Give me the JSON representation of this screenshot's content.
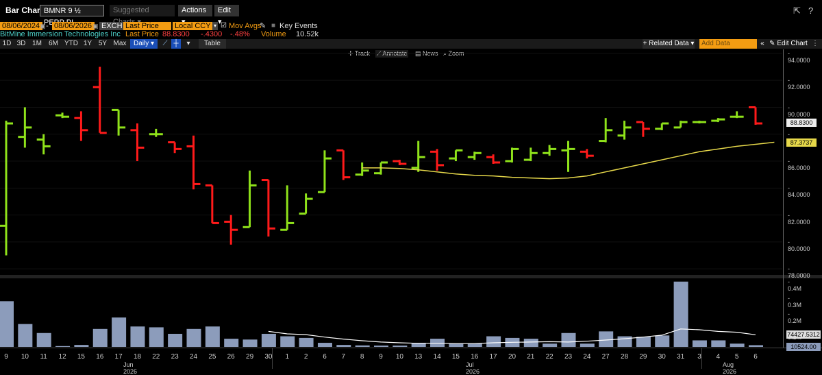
{
  "header": {
    "title": "Bar Chart",
    "ticker": "BMNR 9 ½ PERP PI",
    "suggested": "Suggested Charts",
    "actions": "Actions",
    "edit": "Edit"
  },
  "controls": {
    "start_date": "08/06/2024",
    "end_date": "08/06/2026",
    "exch": "EXCH",
    "price_field": "Last Price",
    "currency": "Local CCY",
    "mov_avgs": "Mov Avgs",
    "key_events": "Key Events"
  },
  "security": {
    "name": "BitMine Immersion Technologies Inc",
    "last_price_label": "Last Price",
    "last_price": "88.8300",
    "change": "-.4300",
    "change_pct": "-.48%",
    "volume_label": "Volume",
    "volume": "10.52k"
  },
  "toolbar": {
    "timeframes": [
      "1D",
      "3D",
      "1M",
      "6M",
      "YTD",
      "1Y",
      "5Y",
      "Max"
    ],
    "period": "Daily",
    "table": "Table",
    "related_data": "Related Data",
    "add_data_placeholder": "Add Data",
    "edit_chart": "Edit Chart",
    "track": "Track",
    "annotate": "Annotate",
    "news": "News",
    "zoom": "Zoom"
  },
  "colors": {
    "up": "#8fe21a",
    "down": "#ff1a1a",
    "ma": "#e6d84a",
    "volume": "#8c9cbb",
    "accent": "#f39c12"
  },
  "chart_data": {
    "type": "ohlc_bar",
    "ylim": [
      77.5,
      94.3
    ],
    "y_ticks": [
      "94.0000",
      "92.0000",
      "90.0000",
      "88.0000",
      "86.0000",
      "84.0000",
      "82.0000",
      "80.0000",
      "78.0000"
    ],
    "x_labels": [
      "9",
      "10",
      "11",
      "12",
      "15",
      "16",
      "17",
      "18",
      "22",
      "23",
      "24",
      "25",
      "26",
      "29",
      "30",
      "1",
      "2",
      "6",
      "7",
      "8",
      "9",
      "10",
      "13",
      "14",
      "15",
      "16",
      "17",
      "20",
      "21",
      "22",
      "23",
      "24",
      "27",
      "28",
      "29",
      "30",
      "31",
      "3",
      "4",
      "5",
      "6"
    ],
    "month_labels": [
      "Jun 2026",
      "Jul 2026",
      "Aug 2026"
    ],
    "bars": [
      {
        "o": 81.2,
        "h": 89.0,
        "l": 79.0,
        "c": 88.8,
        "up": true
      },
      {
        "o": 87.8,
        "h": 90.0,
        "l": 87.0,
        "c": 88.5,
        "up": true
      },
      {
        "o": 87.6,
        "h": 88.0,
        "l": 86.5,
        "c": 87.1,
        "up": true
      },
      {
        "o": 89.4,
        "h": 89.6,
        "l": 89.2,
        "c": 89.3,
        "up": true
      },
      {
        "o": 89.2,
        "h": 89.7,
        "l": 87.5,
        "c": 88.3,
        "up": false
      },
      {
        "o": 91.5,
        "h": 93.0,
        "l": 88.1,
        "c": 88.1,
        "up": false
      },
      {
        "o": 89.8,
        "h": 89.8,
        "l": 87.9,
        "c": 88.5,
        "up": true
      },
      {
        "o": 88.3,
        "h": 88.8,
        "l": 86.0,
        "c": 87.0,
        "up": false
      },
      {
        "o": 88.0,
        "h": 88.4,
        "l": 87.8,
        "c": 88.0,
        "up": true
      },
      {
        "o": 87.4,
        "h": 87.4,
        "l": 86.6,
        "c": 86.9,
        "up": false
      },
      {
        "o": 87.1,
        "h": 87.9,
        "l": 83.9,
        "c": 84.3,
        "up": false
      },
      {
        "o": 84.2,
        "h": 84.2,
        "l": 81.4,
        "c": 81.4,
        "up": false
      },
      {
        "o": 81.5,
        "h": 82.0,
        "l": 79.8,
        "c": 80.9,
        "up": false
      },
      {
        "o": 81.1,
        "h": 85.3,
        "l": 81.1,
        "c": 84.2,
        "up": true
      },
      {
        "o": 84.6,
        "h": 84.6,
        "l": 80.4,
        "c": 81.0,
        "up": false
      },
      {
        "o": 80.9,
        "h": 84.2,
        "l": 80.9,
        "c": 81.4,
        "up": true
      },
      {
        "o": 82.1,
        "h": 83.6,
        "l": 82.1,
        "c": 83.2,
        "up": true
      },
      {
        "o": 83.7,
        "h": 86.8,
        "l": 83.7,
        "c": 86.2,
        "up": true
      },
      {
        "o": 86.8,
        "h": 86.8,
        "l": 84.6,
        "c": 84.8,
        "up": false
      },
      {
        "o": 85.0,
        "h": 85.9,
        "l": 84.9,
        "c": 85.3,
        "up": true
      },
      {
        "o": 85.1,
        "h": 85.9,
        "l": 85.0,
        "c": 85.9,
        "up": true
      },
      {
        "o": 86.0,
        "h": 86.1,
        "l": 85.7,
        "c": 85.8,
        "up": false
      },
      {
        "o": 85.5,
        "h": 87.5,
        "l": 85.2,
        "c": 86.3,
        "up": true
      },
      {
        "o": 86.7,
        "h": 86.9,
        "l": 85.3,
        "c": 85.7,
        "up": false
      },
      {
        "o": 86.2,
        "h": 86.8,
        "l": 86.0,
        "c": 86.8,
        "up": true
      },
      {
        "o": 86.3,
        "h": 86.7,
        "l": 86.1,
        "c": 86.6,
        "up": true
      },
      {
        "o": 86.3,
        "h": 86.5,
        "l": 85.8,
        "c": 85.9,
        "up": false
      },
      {
        "o": 86.0,
        "h": 87.0,
        "l": 85.9,
        "c": 86.9,
        "up": true
      },
      {
        "o": 86.1,
        "h": 87.0,
        "l": 86.0,
        "c": 86.6,
        "up": true
      },
      {
        "o": 86.6,
        "h": 87.2,
        "l": 86.4,
        "c": 86.9,
        "up": true
      },
      {
        "o": 86.8,
        "h": 87.5,
        "l": 85.2,
        "c": 86.9,
        "up": true
      },
      {
        "o": 86.7,
        "h": 86.9,
        "l": 86.2,
        "c": 86.4,
        "up": false
      },
      {
        "o": 87.5,
        "h": 89.2,
        "l": 87.4,
        "c": 88.3,
        "up": true
      },
      {
        "o": 87.9,
        "h": 89.0,
        "l": 87.6,
        "c": 88.5,
        "up": true
      },
      {
        "o": 88.9,
        "h": 88.9,
        "l": 87.8,
        "c": 88.4,
        "up": false
      },
      {
        "o": 88.4,
        "h": 88.8,
        "l": 88.3,
        "c": 88.8,
        "up": true
      },
      {
        "o": 88.5,
        "h": 89.0,
        "l": 88.5,
        "c": 88.9,
        "up": true
      },
      {
        "o": 88.9,
        "h": 89.0,
        "l": 88.8,
        "c": 88.9,
        "up": true
      },
      {
        "o": 89.0,
        "h": 89.2,
        "l": 88.9,
        "c": 89.1,
        "up": true
      },
      {
        "o": 89.3,
        "h": 89.7,
        "l": 89.2,
        "c": 89.3,
        "up": true
      },
      {
        "o": 90.0,
        "h": 90.0,
        "l": 88.7,
        "c": 88.8,
        "up": false
      }
    ],
    "moving_average": {
      "start_index": 19,
      "values": [
        85.5,
        85.5,
        85.45,
        85.35,
        85.2,
        85.05,
        84.95,
        84.9,
        84.8,
        84.75,
        84.7,
        84.75,
        84.9,
        85.2,
        85.5,
        85.8,
        86.1,
        86.4,
        86.7,
        86.9,
        87.1,
        87.25,
        87.4
      ]
    },
    "price_labels": [
      {
        "text": "88.8300",
        "value": 88.83,
        "style": "light"
      },
      {
        "text": "87.3737",
        "value": 87.37,
        "style": "yellow"
      }
    ],
    "volume": {
      "ylim": [
        0,
        420000
      ],
      "y_ticks": [
        "0.4M",
        "0.3M",
        "0.2M",
        "0.1M"
      ],
      "values": [
        280000,
        140000,
        85000,
        5000,
        12000,
        110000,
        180000,
        125000,
        120000,
        80000,
        110000,
        125000,
        50000,
        45000,
        80000,
        65000,
        55000,
        25000,
        12000,
        9000,
        8000,
        8000,
        25000,
        50000,
        20000,
        20000,
        65000,
        55000,
        50000,
        20000,
        85000,
        20000,
        95000,
        65000,
        62000,
        70000,
        400000,
        40000,
        40000,
        20000,
        10524
      ],
      "ma_values": [
        null,
        null,
        null,
        null,
        null,
        null,
        null,
        null,
        null,
        null,
        null,
        null,
        null,
        null,
        95000,
        80000,
        75000,
        60000,
        48000,
        38000,
        30000,
        25000,
        22000,
        22000,
        20000,
        20000,
        25000,
        28000,
        30000,
        32000,
        30000,
        35000,
        42000,
        50000,
        60000,
        72000,
        110000,
        105000,
        95000,
        90000,
        74427
      ],
      "labels": [
        {
          "text": "74427.5312",
          "value": 74427
        },
        {
          "text": "10524.00",
          "value": 10524
        }
      ]
    }
  }
}
